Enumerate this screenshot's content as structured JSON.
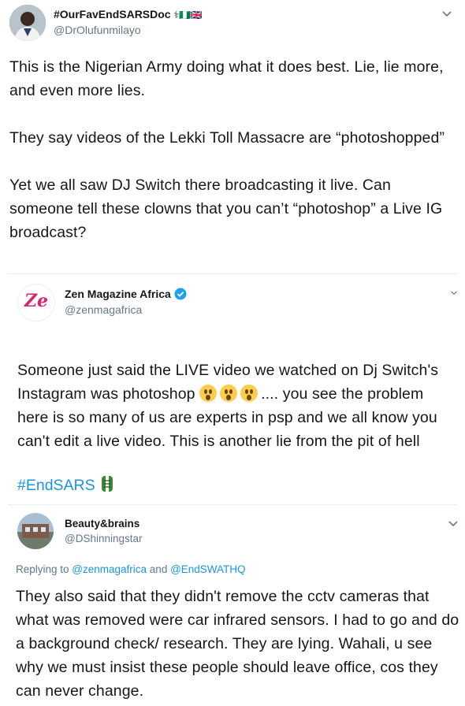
{
  "tweet1": {
    "display_name": "#OurFavEndSARSDoc",
    "name_badges": "⚕🇳🇬🇬🇧",
    "handle": "@DrOlufunmilayo",
    "text": "This is the Nigerian Army doing what it does best. Lie, lie more, and even more lies.\n\nThey say videos of the Lekki Toll Massacre are “photoshopped”\n\nYet we all saw DJ Switch there broadcasting it live. Can someone tell these clowns that you can’t “photoshop” a Live IG broadcast?"
  },
  "quoted": {
    "display_name": "Zen Magazine Africa",
    "handle": "@zenmagafrica",
    "avatar_text": "Ze",
    "text_before_emoji": "Someone just said the LIVE video we watched on Dj Switch's Instagram was photoshop ",
    "text_after_emoji": ".... you see the problem here is so many of us are experts in psp and we all know you can't edit a live video. This is another lie from the pit of hell",
    "hashtag": "#EndSARS",
    "verified": true
  },
  "reply": {
    "display_name": "Beauty&brains",
    "handle": "@DShinningstar",
    "replying_prefix": "Replying to ",
    "mention1": "@zenmagafrica",
    "and_text": " and ",
    "mention2": "@EndSWATHQ",
    "text": "They also said that they didn't remove the cctv cameras that what was removed were car infrared sensors. I had to go and do a background check/ research. They are lying. Wahali, u see why we must insist these people should leave office, cos they can never change."
  },
  "colors": {
    "link": "#1b95e0",
    "secondary_text": "#657786",
    "primary_text": "#14171a",
    "verified_badge": "#1da1f2",
    "zen_brand": "#d6246e"
  }
}
